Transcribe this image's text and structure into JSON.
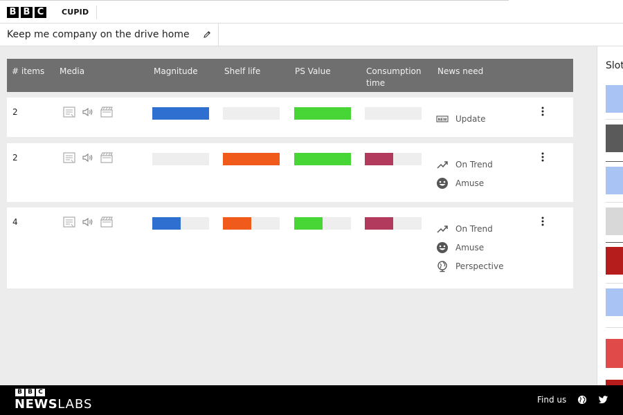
{
  "header": {
    "brand_letters": [
      "B",
      "B",
      "C"
    ],
    "app_name": "CUPID"
  },
  "title": {
    "text": "Keep me company on the drive home",
    "edit_icon": "pencil-icon"
  },
  "table": {
    "columns": [
      "# items",
      "Media",
      "Magnitude",
      "Shelf life",
      "PS Value",
      "Consumption time",
      "News need"
    ],
    "colors": {
      "magnitude": "#2f6fd0",
      "shelf_life": "#f05a1a",
      "ps_value": "#47d636",
      "consumption_time": "#b23a5c",
      "empty": "#eeeeee"
    },
    "rows": [
      {
        "items": "2",
        "media": [
          "text-icon",
          "audio-icon",
          "video-icon"
        ],
        "magnitude": 1.0,
        "shelf_life": 0.0,
        "ps_value": 1.0,
        "consumption_time": 0.0,
        "needs": [
          {
            "icon": "news-icon",
            "label": "Update"
          }
        ]
      },
      {
        "items": "2",
        "media": [
          "text-icon",
          "audio-icon",
          "video-icon"
        ],
        "magnitude": 0.0,
        "shelf_life": 1.0,
        "ps_value": 1.0,
        "consumption_time": 0.5,
        "needs": [
          {
            "icon": "trend-icon",
            "label": "On Trend"
          },
          {
            "icon": "smile-icon",
            "label": "Amuse"
          }
        ]
      },
      {
        "items": "4",
        "media": [
          "text-icon",
          "audio-icon",
          "video-icon"
        ],
        "magnitude": 0.5,
        "shelf_life": 0.5,
        "ps_value": 0.5,
        "consumption_time": 0.5,
        "needs": [
          {
            "icon": "trend-icon",
            "label": "On Trend"
          },
          {
            "icon": "smile-icon",
            "label": "Amuse"
          },
          {
            "icon": "globe-icon",
            "label": "Perspective"
          }
        ]
      }
    ]
  },
  "slots": {
    "title": "Slot"
  },
  "footer": {
    "brand_letters": [
      "B",
      "B",
      "C"
    ],
    "news": "NEWS",
    "labs": "LABS",
    "find_us": "Find us",
    "social": [
      "globe-icon",
      "twitter-icon"
    ]
  }
}
